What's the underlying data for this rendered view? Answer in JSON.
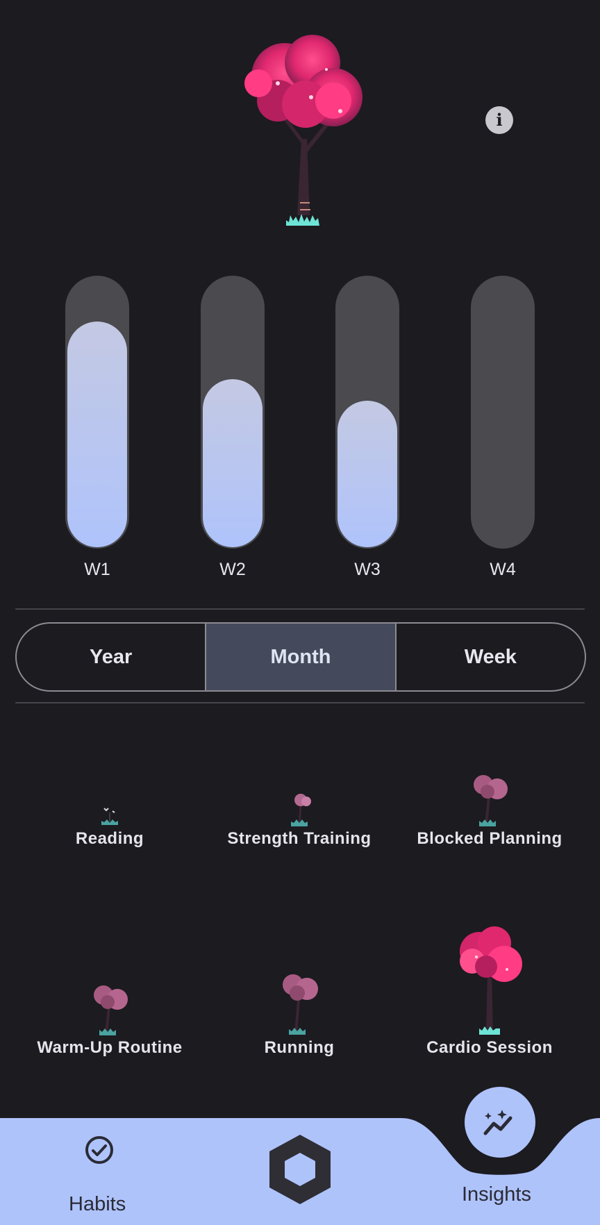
{
  "info_button": {
    "glyph": "i"
  },
  "weekly_progress": [
    {
      "label": "W1",
      "fill": 0.83
    },
    {
      "label": "W2",
      "fill": 0.62
    },
    {
      "label": "W3",
      "fill": 0.54
    },
    {
      "label": "W4",
      "fill": 0.0
    }
  ],
  "period_toggle": {
    "options": [
      "Year",
      "Month",
      "Week"
    ],
    "selected": "Month"
  },
  "habits": [
    {
      "name": "Reading",
      "stage": "sprout"
    },
    {
      "name": "Strength Training",
      "stage": "seedling"
    },
    {
      "name": "Blocked Planning",
      "stage": "young"
    },
    {
      "name": "Warm-Up Routine",
      "stage": "young"
    },
    {
      "name": "Running",
      "stage": "young"
    },
    {
      "name": "Cardio Session",
      "stage": "blooming"
    }
  ],
  "nav": {
    "habits_label": "Habits",
    "insights_label": "Insights"
  },
  "colors": {
    "background": "#1c1b20",
    "accent": "#afc3fb",
    "blossom": "#ff2d7a",
    "track": "#4a4a4f"
  },
  "icons": {
    "info": "info-icon",
    "habits": "check-circle-icon",
    "center": "hexagon-icon",
    "insights": "sparkle-chart-icon"
  }
}
